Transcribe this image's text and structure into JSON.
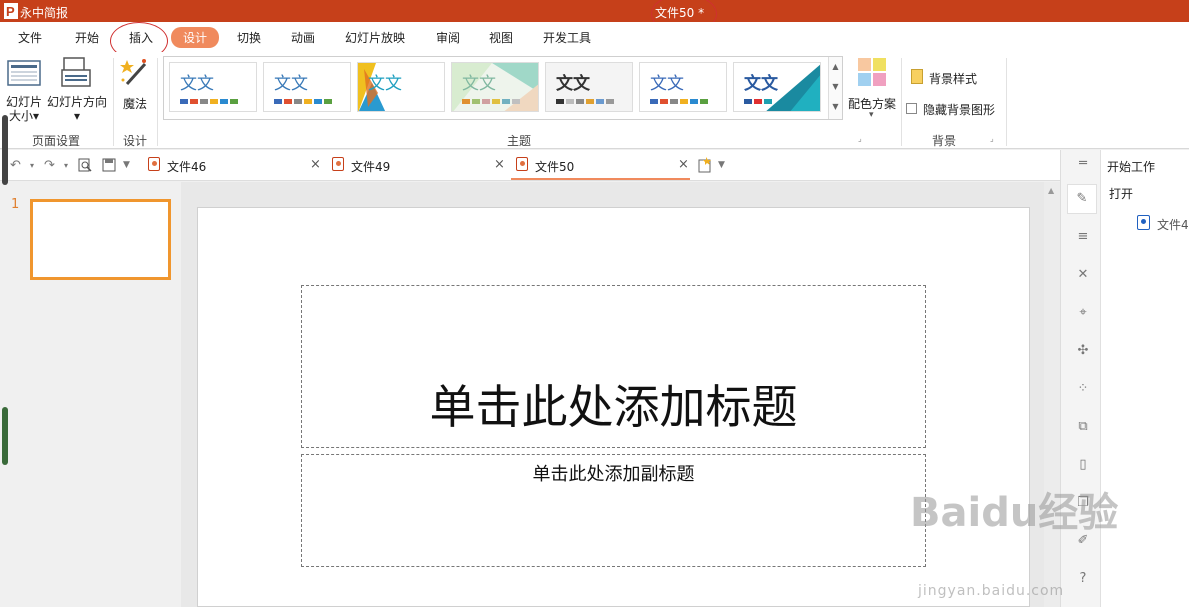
{
  "app": {
    "name": "永中简报",
    "doc_title": "文件50 *"
  },
  "menu": [
    {
      "label": "文件"
    },
    {
      "label": "开始"
    },
    {
      "label": "插入"
    },
    {
      "label": "设计",
      "active": true
    },
    {
      "label": "切换"
    },
    {
      "label": "动画"
    },
    {
      "label": "幻灯片放映"
    },
    {
      "label": "审阅"
    },
    {
      "label": "视图"
    },
    {
      "label": "开发工具"
    }
  ],
  "ribbon": {
    "slide_size": "幻灯片大小",
    "slide_size_line1": "幻灯片",
    "slide_size_line2": "大小",
    "slide_orientation": "幻灯片方向",
    "magic": "魔法",
    "group_page_setup": "页面设置",
    "group_design": "设计",
    "group_theme": "主题",
    "themes": [
      {
        "text": "文文"
      },
      {
        "text": "文文"
      },
      {
        "text": "文文"
      },
      {
        "text": "文文"
      },
      {
        "text": "文文"
      },
      {
        "text": "文文"
      },
      {
        "text": "文文"
      }
    ],
    "color_scheme": "配色方案",
    "background_style": "背景样式",
    "hide_background": "隐藏背景图形",
    "group_background": "背景"
  },
  "tabs": [
    {
      "name": "文件46",
      "close": "×"
    },
    {
      "name": "文件49",
      "close": "×"
    },
    {
      "name": "文件50",
      "close": "×",
      "active": true
    }
  ],
  "slides": [
    {
      "number": "1"
    }
  ],
  "slide": {
    "title_placeholder": "单击此处添加标题",
    "subtitle_placeholder": "单击此处添加副标题"
  },
  "right_pane": {
    "title": "开始工作",
    "open": "打开",
    "recent_file": "文件4"
  },
  "watermark": {
    "main": "Baidu经验",
    "sub": "jingyan.baidu.com"
  },
  "colors": {
    "titlebar": "#c6401a",
    "accent": "#f08a5d",
    "thumb_border": "#f0962e"
  }
}
